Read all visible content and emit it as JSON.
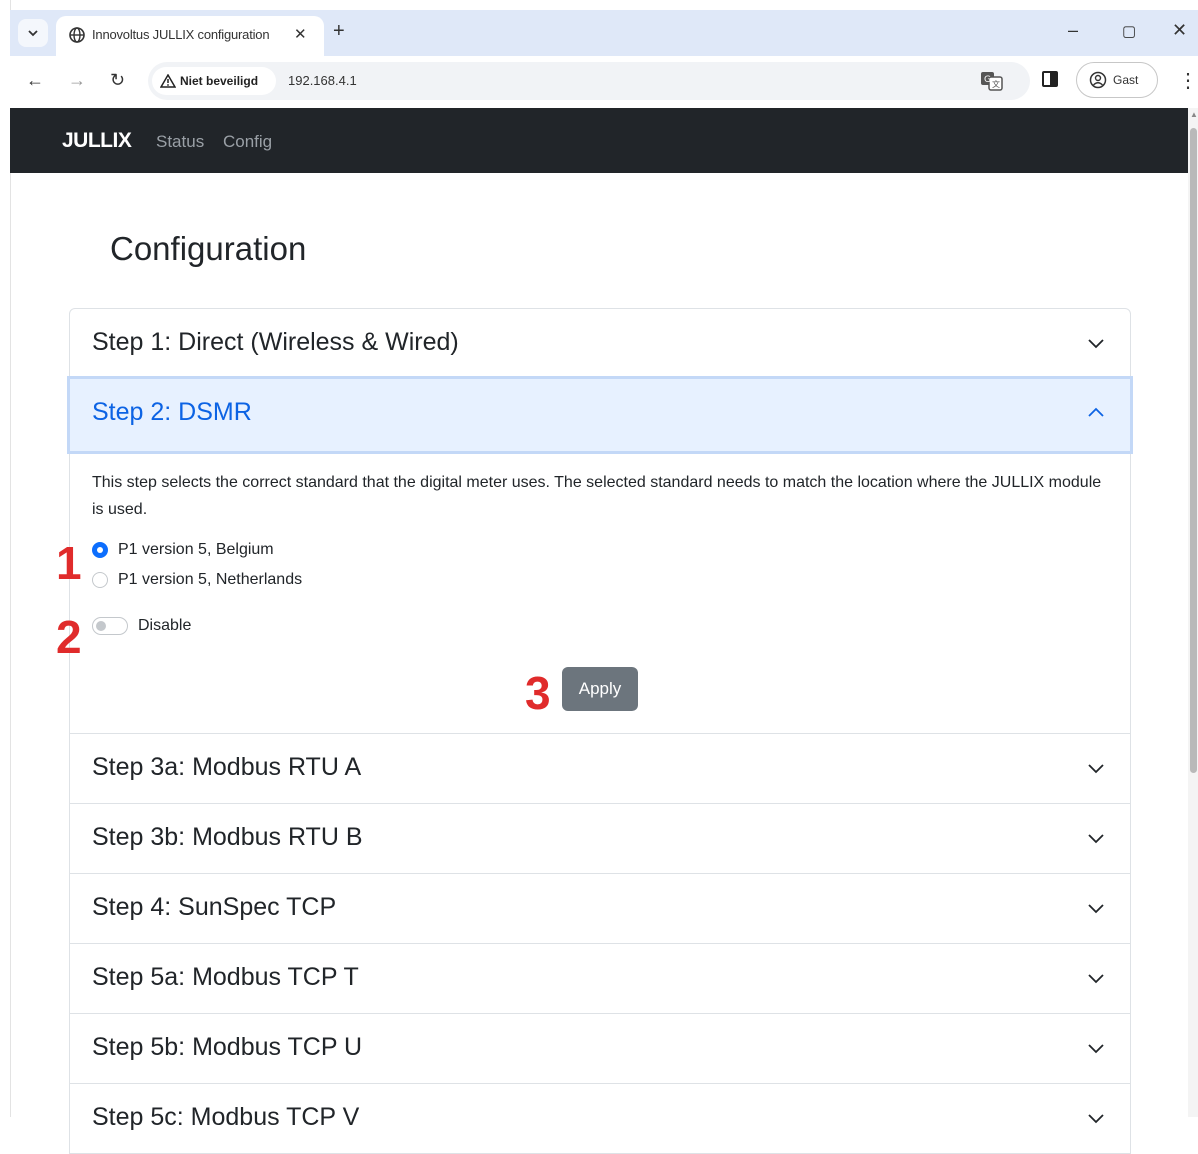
{
  "browser": {
    "tab_title": "Innovoltus JULLIX configuration",
    "security_label": "Niet beveiligd",
    "url": "192.168.4.1",
    "profile_name": "Gast"
  },
  "navbar": {
    "brand": "JULLIX",
    "links": [
      "Status",
      "Config"
    ]
  },
  "page": {
    "title": "Configuration"
  },
  "accordion": {
    "step1": "Step 1: Direct (Wireless & Wired)",
    "step2": "Step 2: DSMR",
    "step3a": "Step 3a: Modbus RTU A",
    "step3b": "Step 3b: Modbus RTU B",
    "step4": "Step 4: SunSpec TCP",
    "step5a": "Step 5a: Modbus TCP T",
    "step5b": "Step 5b: Modbus TCP U",
    "step5c": "Step 5c: Modbus TCP V"
  },
  "dsmr": {
    "description": "This step selects the correct standard that the digital meter uses. The selected standard needs to match the location where the JULLIX module is used.",
    "options": [
      "P1 version 5, Belgium",
      "P1 version 5, Netherlands"
    ],
    "selected_index": 0,
    "disable_label": "Disable",
    "disable_on": false,
    "apply_label": "Apply"
  },
  "annotations": [
    "1",
    "2",
    "3"
  ],
  "colors": {
    "navbar_bg": "#212529",
    "active_header_bg": "#e7f1ff",
    "active_header_text": "#0c63e4",
    "radio_checked": "#0d6efd",
    "apply_bg": "#6c757d",
    "marker_red": "#e02b2b",
    "tabbar_bg": "#dfe8f8"
  }
}
